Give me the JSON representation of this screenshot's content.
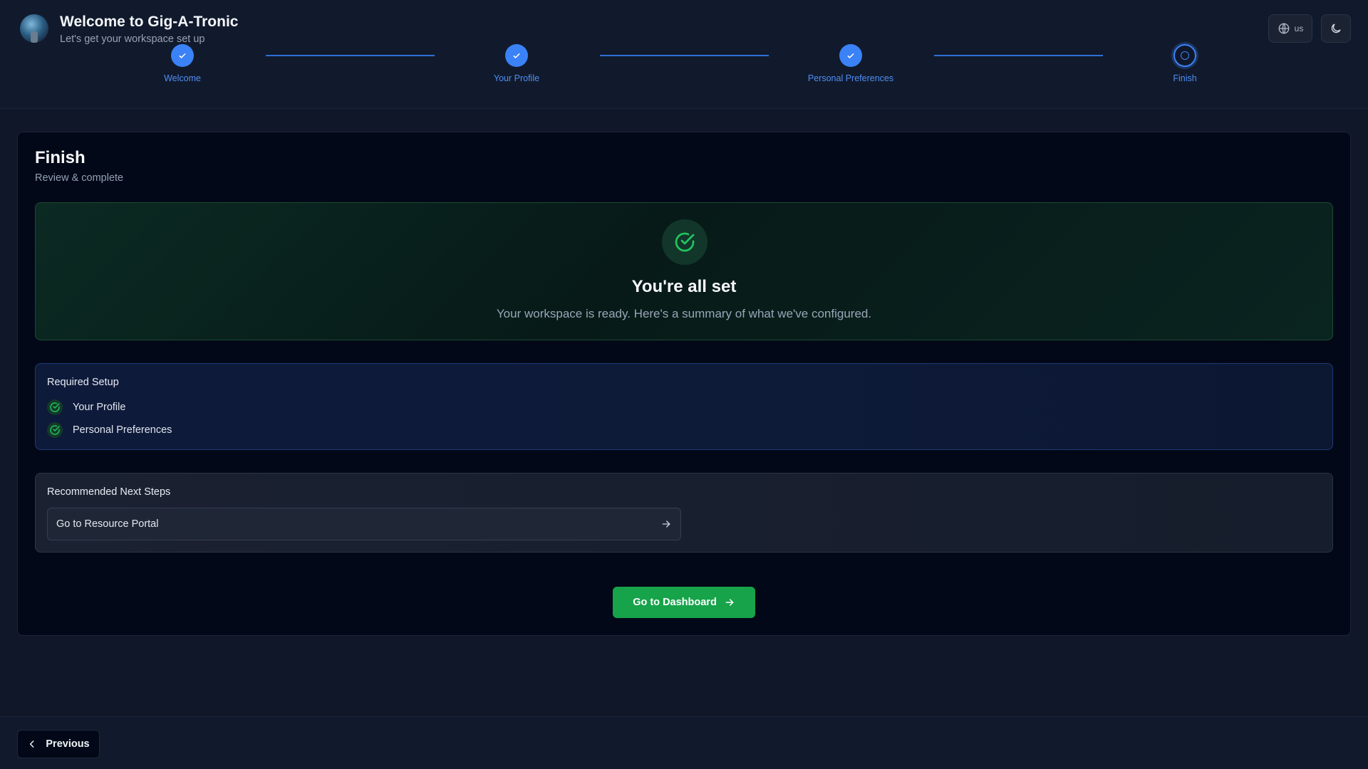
{
  "header": {
    "title": "Welcome to Gig-A-Tronic",
    "subtitle": "Let's get your workspace set up",
    "language_label": "us"
  },
  "stepper": {
    "steps": [
      {
        "label": "Welcome",
        "status": "complete"
      },
      {
        "label": "Your Profile",
        "status": "complete"
      },
      {
        "label": "Personal Preferences",
        "status": "complete"
      },
      {
        "label": "Finish",
        "status": "current"
      }
    ]
  },
  "card": {
    "title": "Finish",
    "subtitle": "Review & complete"
  },
  "success": {
    "title": "You're all set",
    "message": "Your workspace is ready. Here's a summary of what we've configured."
  },
  "required_setup": {
    "title": "Required Setup",
    "items": [
      {
        "label": "Your Profile",
        "status": "done"
      },
      {
        "label": "Personal Preferences",
        "status": "done"
      }
    ]
  },
  "next_steps": {
    "title": "Recommended Next Steps",
    "links": [
      {
        "label": "Go to Resource Portal"
      }
    ]
  },
  "actions": {
    "dashboard_label": "Go to Dashboard",
    "previous_label": "Previous"
  },
  "colors": {
    "background": "#0f1729",
    "card": "#020817",
    "accent_blue": "#3b82f6",
    "success_green": "#16a34a",
    "check_green": "#22c55e"
  },
  "icons": {
    "language": "globe-icon",
    "theme": "moon-icon",
    "step_complete": "check-icon",
    "success": "circle-check-icon",
    "next_link": "arrow-right-icon",
    "previous": "chevron-left-icon"
  }
}
